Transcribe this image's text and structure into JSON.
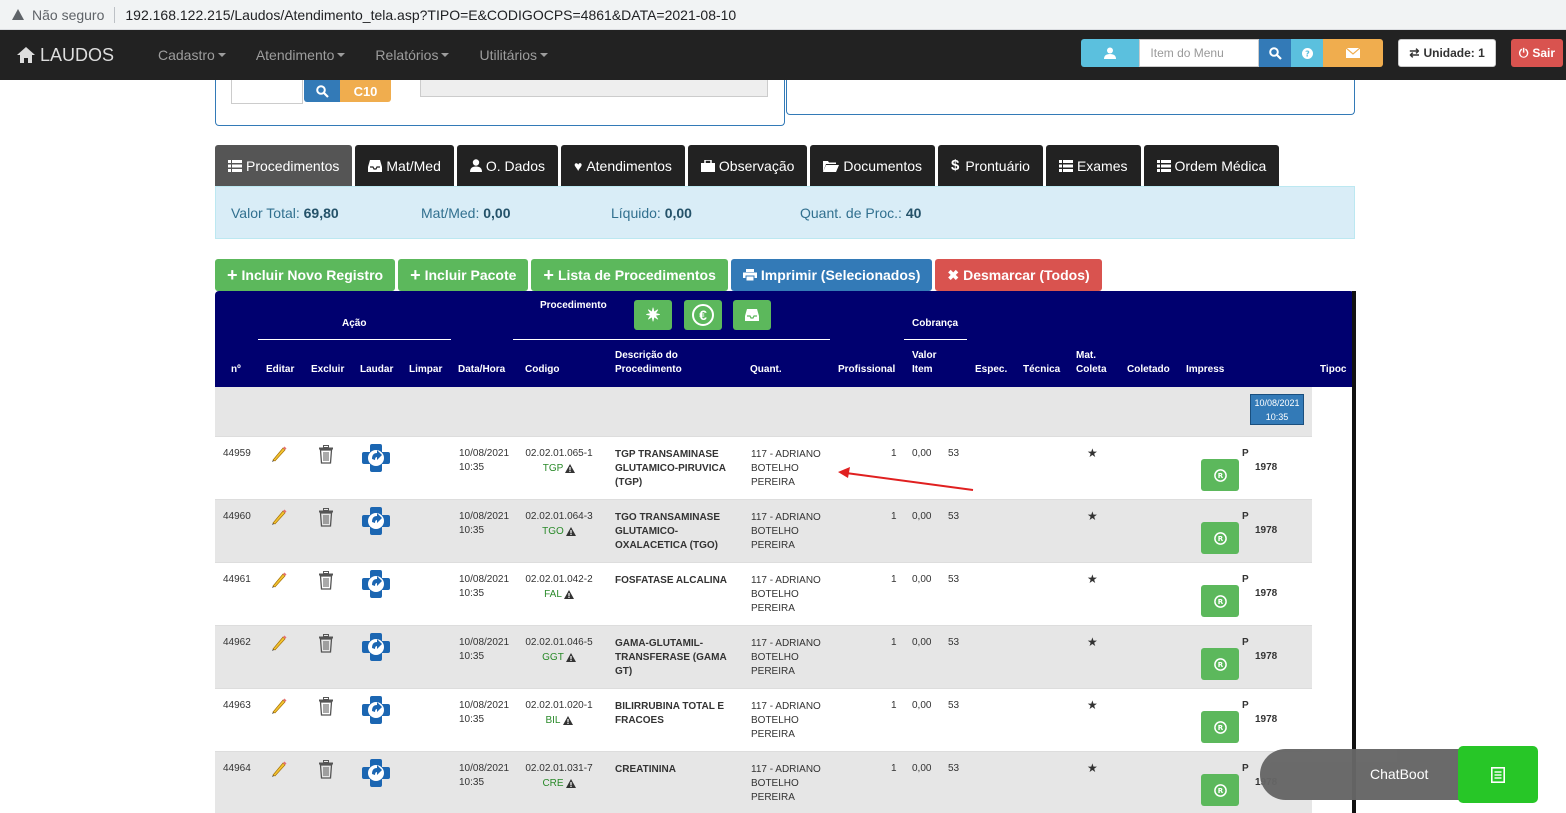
{
  "browser": {
    "security": "Não seguro",
    "url": "192.168.122.215/Laudos/Atendimento_tela.asp?TIPO=E&CODIGOCPS=4861&DATA=2021-08-10"
  },
  "navbar": {
    "brand": "LAUDOS",
    "menu": [
      "Cadastro",
      "Atendimento",
      "Relatórios",
      "Utilitários"
    ],
    "menu_placeholder": "Item do Menu",
    "unit": "Unidade: 1",
    "exit": "Sair"
  },
  "top_panel": {
    "c10_label": "C10"
  },
  "tabs": [
    "Procedimentos",
    "Mat/Med",
    "O. Dados",
    "Atendimentos",
    "Observação",
    "Documentos",
    "Prontuário",
    "Exames",
    "Ordem Médica"
  ],
  "summary": {
    "valor_total_label": "Valor Total:",
    "valor_total": "69,80",
    "matmed_label": "Mat/Med:",
    "matmed": "0,00",
    "liquido_label": "Líquido:",
    "liquido": "0,00",
    "quant_label": "Quant. de Proc.:",
    "quant": "40"
  },
  "actions": {
    "incluir_registro": "Incluir Novo Registro",
    "incluir_pacote": "Incluir Pacote",
    "lista_proc": "Lista de Procedimentos",
    "imprimir": "Imprimir (Selecionados)",
    "desmarcar": "Desmarcar (Todos)"
  },
  "table": {
    "group_acao": "Ação",
    "group_procedimento": "Procedimento",
    "group_cobranca": "Cobrança",
    "headers": {
      "n": "nº",
      "editar": "Editar",
      "excluir": "Excluir",
      "laudar": "Laudar",
      "limpar": "Limpar",
      "datahora": "Data/Hora",
      "codigo": "Codigo",
      "descricao1": "Descrição do",
      "descricao2": "Procedimento",
      "quant": "Quant.",
      "profissional": "Profissional",
      "valor1": "Valor",
      "valor2": "Item",
      "espec": "Espec.",
      "tecnica": "Técnica",
      "matcoleta1": "Mat.",
      "matcoleta2": "Coleta",
      "coletado": "Coletado",
      "impress": "Impress",
      "tipoc": "Tipoc"
    },
    "date_badge": {
      "date": "10/08/2021",
      "time": "10:35"
    },
    "rows": [
      {
        "n": "44959",
        "date": "10/08/2021",
        "time": "10:35",
        "code": "02.02.01.065-1",
        "abbr": "TGP",
        "desc": [
          "TGP TRANSAMINASE",
          "GLUTAMICO-PIRUVICA",
          "(TGP)"
        ],
        "prof": [
          "117 - ADRIANO",
          "BOTELHO",
          "PEREIRA"
        ],
        "quant": "1",
        "valor": "0,00",
        "espec": "53",
        "mat": "★",
        "p": "P",
        "year": "1978"
      },
      {
        "n": "44960",
        "date": "10/08/2021",
        "time": "10:35",
        "code": "02.02.01.064-3",
        "abbr": "TGO",
        "desc": [
          "TGO TRANSAMINASE",
          "GLUTAMICO-",
          "OXALACETICA (TGO)"
        ],
        "prof": [
          "117 - ADRIANO",
          "BOTELHO",
          "PEREIRA"
        ],
        "quant": "1",
        "valor": "0,00",
        "espec": "53",
        "mat": "★",
        "p": "P",
        "year": "1978"
      },
      {
        "n": "44961",
        "date": "10/08/2021",
        "time": "10:35",
        "code": "02.02.01.042-2",
        "abbr": "FAL",
        "desc": [
          "FOSFATASE ALCALINA",
          "",
          ""
        ],
        "prof": [
          "117 - ADRIANO",
          "BOTELHO",
          "PEREIRA"
        ],
        "quant": "1",
        "valor": "0,00",
        "espec": "53",
        "mat": "★",
        "p": "P",
        "year": "1978"
      },
      {
        "n": "44962",
        "date": "10/08/2021",
        "time": "10:35",
        "code": "02.02.01.046-5",
        "abbr": "GGT",
        "desc": [
          "GAMA-GLUTAMIL-",
          "TRANSFERASE (GAMA",
          "GT)"
        ],
        "prof": [
          "117 - ADRIANO",
          "BOTELHO",
          "PEREIRA"
        ],
        "quant": "1",
        "valor": "0,00",
        "espec": "53",
        "mat": "★",
        "p": "P",
        "year": "1978"
      },
      {
        "n": "44963",
        "date": "10/08/2021",
        "time": "10:35",
        "code": "02.02.01.020-1",
        "abbr": "BIL",
        "desc": [
          "BILIRRUBINA TOTAL E",
          "FRACOES",
          ""
        ],
        "prof": [
          "117 - ADRIANO",
          "BOTELHO",
          "PEREIRA"
        ],
        "quant": "1",
        "valor": "0,00",
        "espec": "53",
        "mat": "★",
        "p": "P",
        "year": "1978"
      },
      {
        "n": "44964",
        "date": "10/08/2021",
        "time": "10:35",
        "code": "02.02.01.031-7",
        "abbr": "CRE",
        "desc": [
          "CREATININA",
          "",
          ""
        ],
        "prof": [
          "117 - ADRIANO",
          "BOTELHO",
          "PEREIRA"
        ],
        "quant": "1",
        "valor": "0,00",
        "espec": "53",
        "mat": "★",
        "p": "P",
        "year": "1978"
      }
    ]
  },
  "chat": {
    "label": "ChatBoot"
  },
  "colors": {
    "navbar": "#222222",
    "table_header": "#00006f",
    "green": "#5cb85c",
    "blue": "#337ab7",
    "red": "#d9534f",
    "annotation_arrow": "#e02020"
  }
}
